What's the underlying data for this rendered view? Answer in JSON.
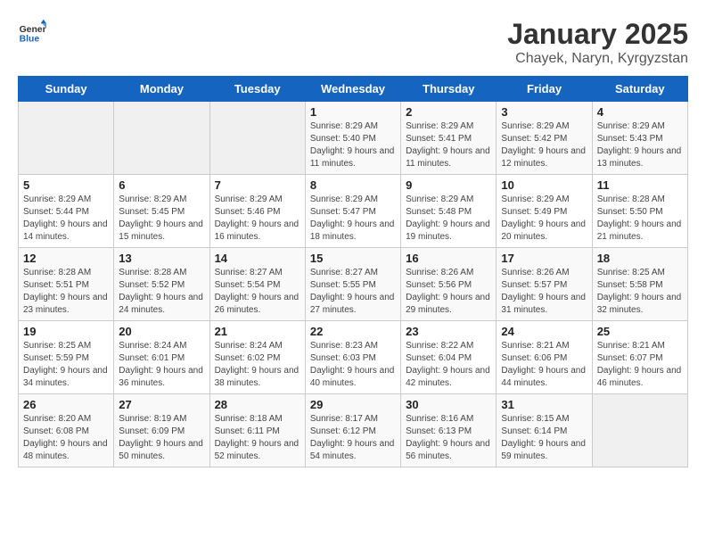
{
  "logo": {
    "line1": "General",
    "line2": "Blue"
  },
  "title": "January 2025",
  "subtitle": "Chayek, Naryn, Kyrgyzstan",
  "weekdays": [
    "Sunday",
    "Monday",
    "Tuesday",
    "Wednesday",
    "Thursday",
    "Friday",
    "Saturday"
  ],
  "weeks": [
    [
      {
        "day": "",
        "info": ""
      },
      {
        "day": "",
        "info": ""
      },
      {
        "day": "",
        "info": ""
      },
      {
        "day": "1",
        "info": "Sunrise: 8:29 AM\nSunset: 5:40 PM\nDaylight: 9 hours and 11 minutes."
      },
      {
        "day": "2",
        "info": "Sunrise: 8:29 AM\nSunset: 5:41 PM\nDaylight: 9 hours and 11 minutes."
      },
      {
        "day": "3",
        "info": "Sunrise: 8:29 AM\nSunset: 5:42 PM\nDaylight: 9 hours and 12 minutes."
      },
      {
        "day": "4",
        "info": "Sunrise: 8:29 AM\nSunset: 5:43 PM\nDaylight: 9 hours and 13 minutes."
      }
    ],
    [
      {
        "day": "5",
        "info": "Sunrise: 8:29 AM\nSunset: 5:44 PM\nDaylight: 9 hours and 14 minutes."
      },
      {
        "day": "6",
        "info": "Sunrise: 8:29 AM\nSunset: 5:45 PM\nDaylight: 9 hours and 15 minutes."
      },
      {
        "day": "7",
        "info": "Sunrise: 8:29 AM\nSunset: 5:46 PM\nDaylight: 9 hours and 16 minutes."
      },
      {
        "day": "8",
        "info": "Sunrise: 8:29 AM\nSunset: 5:47 PM\nDaylight: 9 hours and 18 minutes."
      },
      {
        "day": "9",
        "info": "Sunrise: 8:29 AM\nSunset: 5:48 PM\nDaylight: 9 hours and 19 minutes."
      },
      {
        "day": "10",
        "info": "Sunrise: 8:29 AM\nSunset: 5:49 PM\nDaylight: 9 hours and 20 minutes."
      },
      {
        "day": "11",
        "info": "Sunrise: 8:28 AM\nSunset: 5:50 PM\nDaylight: 9 hours and 21 minutes."
      }
    ],
    [
      {
        "day": "12",
        "info": "Sunrise: 8:28 AM\nSunset: 5:51 PM\nDaylight: 9 hours and 23 minutes."
      },
      {
        "day": "13",
        "info": "Sunrise: 8:28 AM\nSunset: 5:52 PM\nDaylight: 9 hours and 24 minutes."
      },
      {
        "day": "14",
        "info": "Sunrise: 8:27 AM\nSunset: 5:54 PM\nDaylight: 9 hours and 26 minutes."
      },
      {
        "day": "15",
        "info": "Sunrise: 8:27 AM\nSunset: 5:55 PM\nDaylight: 9 hours and 27 minutes."
      },
      {
        "day": "16",
        "info": "Sunrise: 8:26 AM\nSunset: 5:56 PM\nDaylight: 9 hours and 29 minutes."
      },
      {
        "day": "17",
        "info": "Sunrise: 8:26 AM\nSunset: 5:57 PM\nDaylight: 9 hours and 31 minutes."
      },
      {
        "day": "18",
        "info": "Sunrise: 8:25 AM\nSunset: 5:58 PM\nDaylight: 9 hours and 32 minutes."
      }
    ],
    [
      {
        "day": "19",
        "info": "Sunrise: 8:25 AM\nSunset: 5:59 PM\nDaylight: 9 hours and 34 minutes."
      },
      {
        "day": "20",
        "info": "Sunrise: 8:24 AM\nSunset: 6:01 PM\nDaylight: 9 hours and 36 minutes."
      },
      {
        "day": "21",
        "info": "Sunrise: 8:24 AM\nSunset: 6:02 PM\nDaylight: 9 hours and 38 minutes."
      },
      {
        "day": "22",
        "info": "Sunrise: 8:23 AM\nSunset: 6:03 PM\nDaylight: 9 hours and 40 minutes."
      },
      {
        "day": "23",
        "info": "Sunrise: 8:22 AM\nSunset: 6:04 PM\nDaylight: 9 hours and 42 minutes."
      },
      {
        "day": "24",
        "info": "Sunrise: 8:21 AM\nSunset: 6:06 PM\nDaylight: 9 hours and 44 minutes."
      },
      {
        "day": "25",
        "info": "Sunrise: 8:21 AM\nSunset: 6:07 PM\nDaylight: 9 hours and 46 minutes."
      }
    ],
    [
      {
        "day": "26",
        "info": "Sunrise: 8:20 AM\nSunset: 6:08 PM\nDaylight: 9 hours and 48 minutes."
      },
      {
        "day": "27",
        "info": "Sunrise: 8:19 AM\nSunset: 6:09 PM\nDaylight: 9 hours and 50 minutes."
      },
      {
        "day": "28",
        "info": "Sunrise: 8:18 AM\nSunset: 6:11 PM\nDaylight: 9 hours and 52 minutes."
      },
      {
        "day": "29",
        "info": "Sunrise: 8:17 AM\nSunset: 6:12 PM\nDaylight: 9 hours and 54 minutes."
      },
      {
        "day": "30",
        "info": "Sunrise: 8:16 AM\nSunset: 6:13 PM\nDaylight: 9 hours and 56 minutes."
      },
      {
        "day": "31",
        "info": "Sunrise: 8:15 AM\nSunset: 6:14 PM\nDaylight: 9 hours and 59 minutes."
      },
      {
        "day": "",
        "info": ""
      }
    ]
  ]
}
